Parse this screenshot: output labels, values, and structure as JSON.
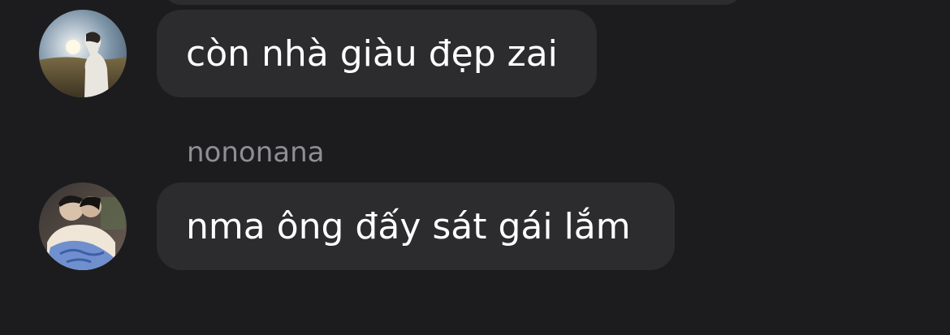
{
  "colors": {
    "background": "#1c1c1e",
    "bubble": "#2c2c2e",
    "message_text": "#ffffff",
    "sender_name": "#8e8e93"
  },
  "messages": [
    {
      "avatar": "avatar-sunset-person",
      "text": "còn nhà giàu đẹp zai"
    },
    {
      "sender": "nononana",
      "avatar": "avatar-couple-photo",
      "text": "nma ông đấy sát gái lắm"
    }
  ]
}
